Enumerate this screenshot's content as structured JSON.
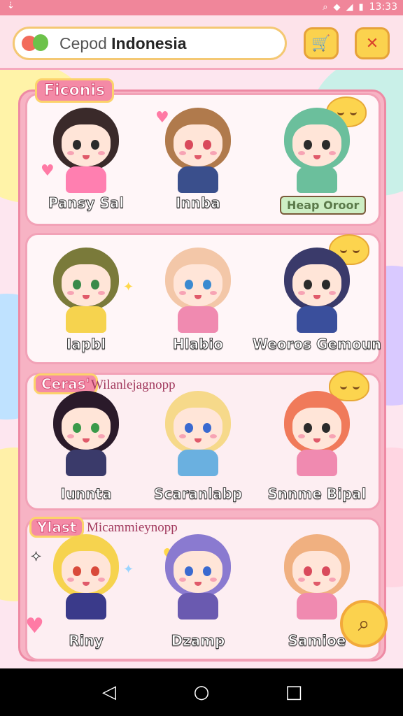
{
  "status_bar": {
    "time": "13:33",
    "left_icon": "download-arrow-icon",
    "right_icons": [
      "search-icon",
      "wifi-icon",
      "signal-icon",
      "battery-icon"
    ]
  },
  "search": {
    "placeholder": "Cepod",
    "value": "Indonesia",
    "logo_icon": "app-logo-icon"
  },
  "toolbar": {
    "cart_icon": "cart-icon",
    "close_icon": "close-icon"
  },
  "sections": [
    {
      "tag": "Ficonis",
      "subtitle": "",
      "characters": [
        {
          "name": "Pansy Sal",
          "hair": "#3a2a2a",
          "shirt": "#ff7fb0",
          "eyes": "#2b2b2b"
        },
        {
          "name": "Innba",
          "hair": "#b07a4c",
          "shirt": "#3a4f8c",
          "eyes": "#d94a5c"
        },
        {
          "name": "Heap Oroor",
          "hair": "#6bbf9c",
          "shirt": "#6bbf9c",
          "eyes": "#2b2b2b"
        }
      ]
    },
    {
      "tag": "",
      "subtitle": "",
      "characters": [
        {
          "name": "Iapbl",
          "hair": "#7a7a3a",
          "shirt": "#f6d34e",
          "eyes": "#3a8a4a"
        },
        {
          "name": "Hlabio",
          "hair": "#f3c7a8",
          "shirt": "#f08ab0",
          "eyes": "#3a8ad0"
        },
        {
          "name": "Weoros Gemoun",
          "hair": "#3a3a6a",
          "shirt": "#3a4f9c",
          "eyes": "#2b2b2b"
        }
      ]
    },
    {
      "tag": "Ceras'",
      "subtitle": "Wilanlejagnopp",
      "characters": [
        {
          "name": "Iunnta",
          "hair": "#2a1a2a",
          "shirt": "#3a3a6a",
          "eyes": "#3a9a4a"
        },
        {
          "name": "Scaranlabp",
          "hair": "#f6d98a",
          "shirt": "#6ab0e0",
          "eyes": "#3a6ad0"
        },
        {
          "name": "Snnme Bipal",
          "hair": "#f07a5a",
          "shirt": "#f08ab0",
          "eyes": "#2b2b2b"
        }
      ]
    },
    {
      "tag": "Ylast",
      "subtitle": "Micammieynopp",
      "characters": [
        {
          "name": "Riny",
          "hair": "#f6d34e",
          "shirt": "#3a3a8a",
          "eyes": "#d94a3a"
        },
        {
          "name": "Dzamp",
          "hair": "#8a7ad0",
          "shirt": "#6a5ab0",
          "eyes": "#3a6ad0"
        },
        {
          "name": "Samioe",
          "hair": "#f0b080",
          "shirt": "#f08ab0",
          "eyes": "#d94a5c"
        }
      ]
    }
  ],
  "fab_icon": "search-icon",
  "nav": {
    "back_icon": "back-icon",
    "home_icon": "home-icon",
    "recent_icon": "recent-apps-icon",
    "back_glyph": "◁",
    "home_glyph": "○",
    "recent_glyph": "□"
  },
  "colors": {
    "accent_pink": "#f48aa6",
    "accent_yellow": "#fbd24e",
    "status_bar": "#f0869a"
  }
}
